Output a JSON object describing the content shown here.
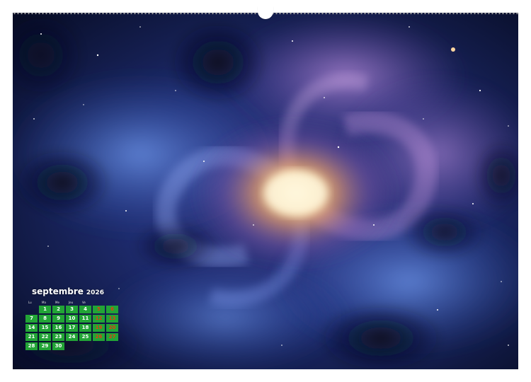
{
  "calendar": {
    "month": "septembre",
    "year": "2026",
    "weekdays": [
      "Lu",
      "Ma",
      "Me",
      "Jeu",
      "Ve",
      "",
      ""
    ],
    "rows": [
      [
        "",
        "1",
        "2",
        "3",
        "4",
        "5",
        "6"
      ],
      [
        "7",
        "8",
        "9",
        "10",
        "11",
        "12",
        "13"
      ],
      [
        "14",
        "15",
        "16",
        "17",
        "18",
        "19",
        "20"
      ],
      [
        "21",
        "22",
        "23",
        "24",
        "25",
        "26",
        "27"
      ],
      [
        "28",
        "29",
        "30",
        "",
        "",
        "",
        ""
      ]
    ]
  },
  "colors": {
    "day_cell": "#22a436",
    "weekend_text": "#e63b12",
    "month_title": "#ffffff"
  },
  "image": {
    "subject": "galaxy-nebula"
  }
}
